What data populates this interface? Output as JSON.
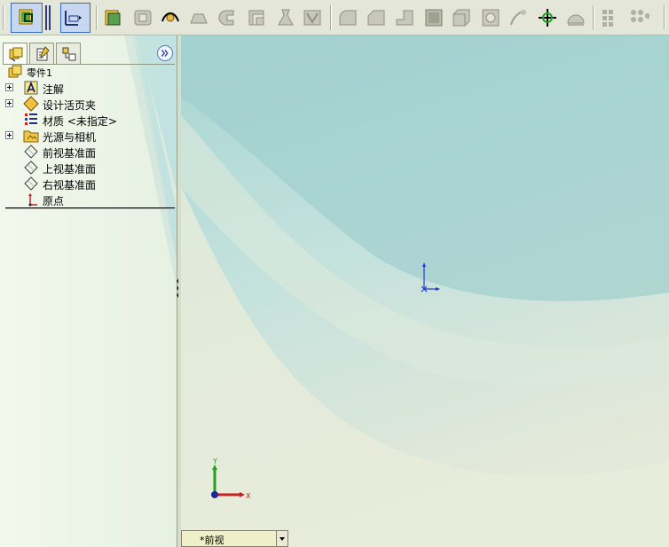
{
  "toolbar": {
    "tools": [
      "sketch-icon",
      "smart-dimension-icon",
      "extrude-icon",
      "revolve-icon",
      "sweep-icon",
      "loft-icon",
      "rib-icon",
      "shell-icon",
      "draft-icon",
      "wrap-icon",
      "fillet-icon",
      "chamfer-icon",
      "hole-wizard-icon",
      "scale-icon",
      "split-icon",
      "dome-icon",
      "curves-icon",
      "move-face-icon",
      "flex-icon",
      "linear-pattern-icon",
      "circular-pattern-icon"
    ]
  },
  "left_panel": {
    "tabs": [
      "feature-manager-tab",
      "property-manager-tab",
      "configuration-manager-tab"
    ],
    "tree": {
      "root": "零件1",
      "items": [
        {
          "label": "注解",
          "icon": "annotation-icon",
          "expandable": true
        },
        {
          "label": "设计活页夹",
          "icon": "design-binder-icon",
          "expandable": true
        },
        {
          "label": "材质 <未指定>",
          "icon": "material-icon",
          "expandable": false
        },
        {
          "label": "光源与相机",
          "icon": "lights-cameras-icon",
          "expandable": true
        },
        {
          "label": "前视基准面",
          "icon": "plane-icon",
          "expandable": false
        },
        {
          "label": "上视基准面",
          "icon": "plane-icon",
          "expandable": false
        },
        {
          "label": "右视基准面",
          "icon": "plane-icon",
          "expandable": false
        },
        {
          "label": "原点",
          "icon": "origin-icon",
          "expandable": false
        }
      ]
    }
  },
  "viewport": {
    "view_orientation": "*前视",
    "triad": {
      "x_label": "X",
      "y_label": "Y"
    }
  },
  "colors": {
    "accent": "#316ac5",
    "viewport_top": "#9ecfcf",
    "viewport_bottom": "#e3e8d6",
    "panel_bg": "#eaf4e4",
    "rollback_bar": "#e8c800"
  }
}
